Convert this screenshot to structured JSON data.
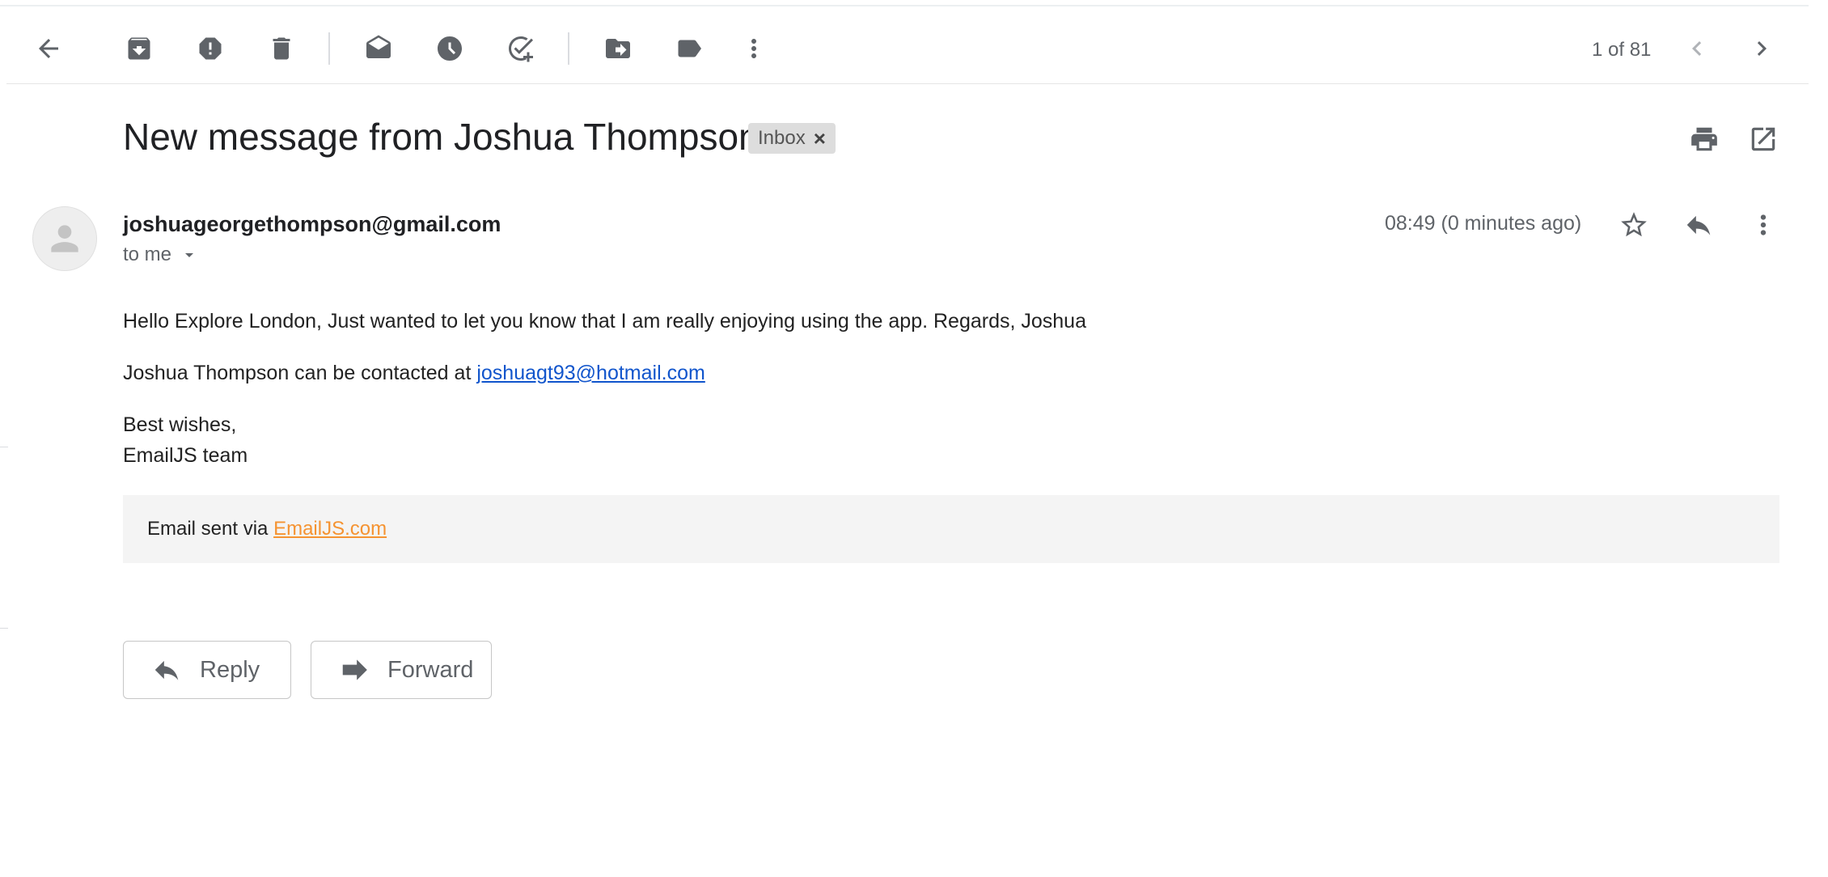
{
  "toolbar": {
    "back_icon": "arrow-back-icon",
    "archive_icon": "archive-icon",
    "spam_icon": "report-spam-icon",
    "delete_icon": "delete-icon",
    "mark_unread_icon": "mark-unread-icon",
    "snooze_icon": "snooze-icon",
    "add_task_icon": "add-to-tasks-icon",
    "move_icon": "move-to-icon",
    "label_icon": "label-icon",
    "more_icon": "more-vert-icon",
    "pager_text": "1 of 81",
    "prev_icon": "chevron-left-icon",
    "next_icon": "chevron-right-icon"
  },
  "message": {
    "subject": "New message from Joshua Thompson",
    "label": "Inbox",
    "label_remove": "×",
    "sender": "joshuageorgethompson@gmail.com",
    "to": "to me",
    "timestamp": "08:49 (0 minutes ago)",
    "body": {
      "line1": "Hello Explore London, Just wanted to let you know that I am really enjoying using the app. Regards, Joshua",
      "contact_prefix": "Joshua Thompson can be contacted at ",
      "contact_email": "joshuagt93@hotmail.com",
      "signoff1": "Best wishes,",
      "signoff2": "EmailJS team"
    },
    "footer": {
      "prefix": "Email sent via ",
      "link": "EmailJS.com"
    }
  },
  "actions": {
    "reply": "Reply",
    "forward": "Forward"
  },
  "colors": {
    "link_blue": "#1155cc",
    "link_orange": "#f59331",
    "icon_grey": "#5f6368"
  }
}
